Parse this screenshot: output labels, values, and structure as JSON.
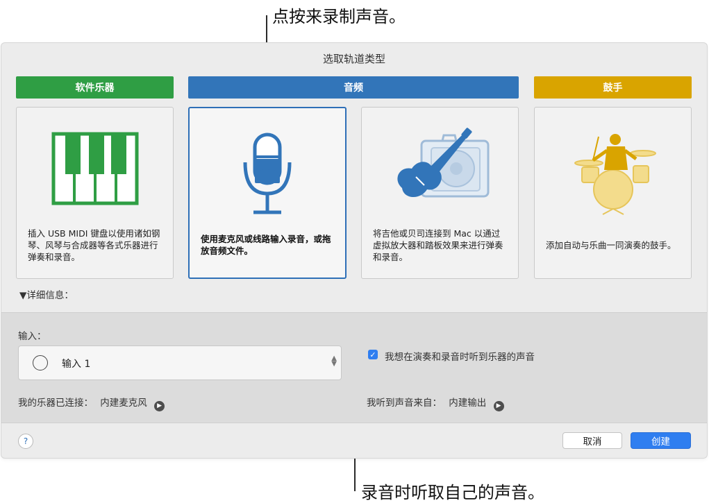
{
  "callouts": {
    "top": "点按来录制声音。",
    "bottom": "录音时听取自己的声音。"
  },
  "dialog": {
    "title": "选取轨道类型",
    "categories": [
      {
        "label": "软件乐器",
        "color": "#2f9e44"
      },
      {
        "label": "音频",
        "color": "#3275b9"
      },
      {
        "label": "鼓手",
        "color": "#d9a400"
      }
    ],
    "cards": [
      {
        "desc": "插入 USB MIDI 键盘以使用诸如钢琴、风琴与合成器等各式乐器进行弹奏和录音。",
        "icon": "piano-keys-icon"
      },
      {
        "desc": "使用麦克风或线路输入录音，或拖放音频文件。",
        "icon": "microphone-icon"
      },
      {
        "desc": "将吉他或贝司连接到 Mac 以通过虚拟放大器和踏板效果来进行弹奏和录音。",
        "icon": "guitar-amp-icon"
      },
      {
        "desc": "添加自动与乐曲一同演奏的鼓手。",
        "icon": "drummer-icon"
      }
    ],
    "details_label": "▼详细信息：",
    "input_label": "输入：",
    "input_value": "输入 1",
    "monitor_label": "我想在演奏和录音时听到乐器的声音",
    "instrument_connected_label": "我的乐器已连接：",
    "instrument_connected_value": "内建麦克风",
    "hear_from_label": "我听到声音来自：",
    "hear_from_value": "内建输出",
    "help_label": "?",
    "cancel_label": "取消",
    "create_label": "创建"
  }
}
